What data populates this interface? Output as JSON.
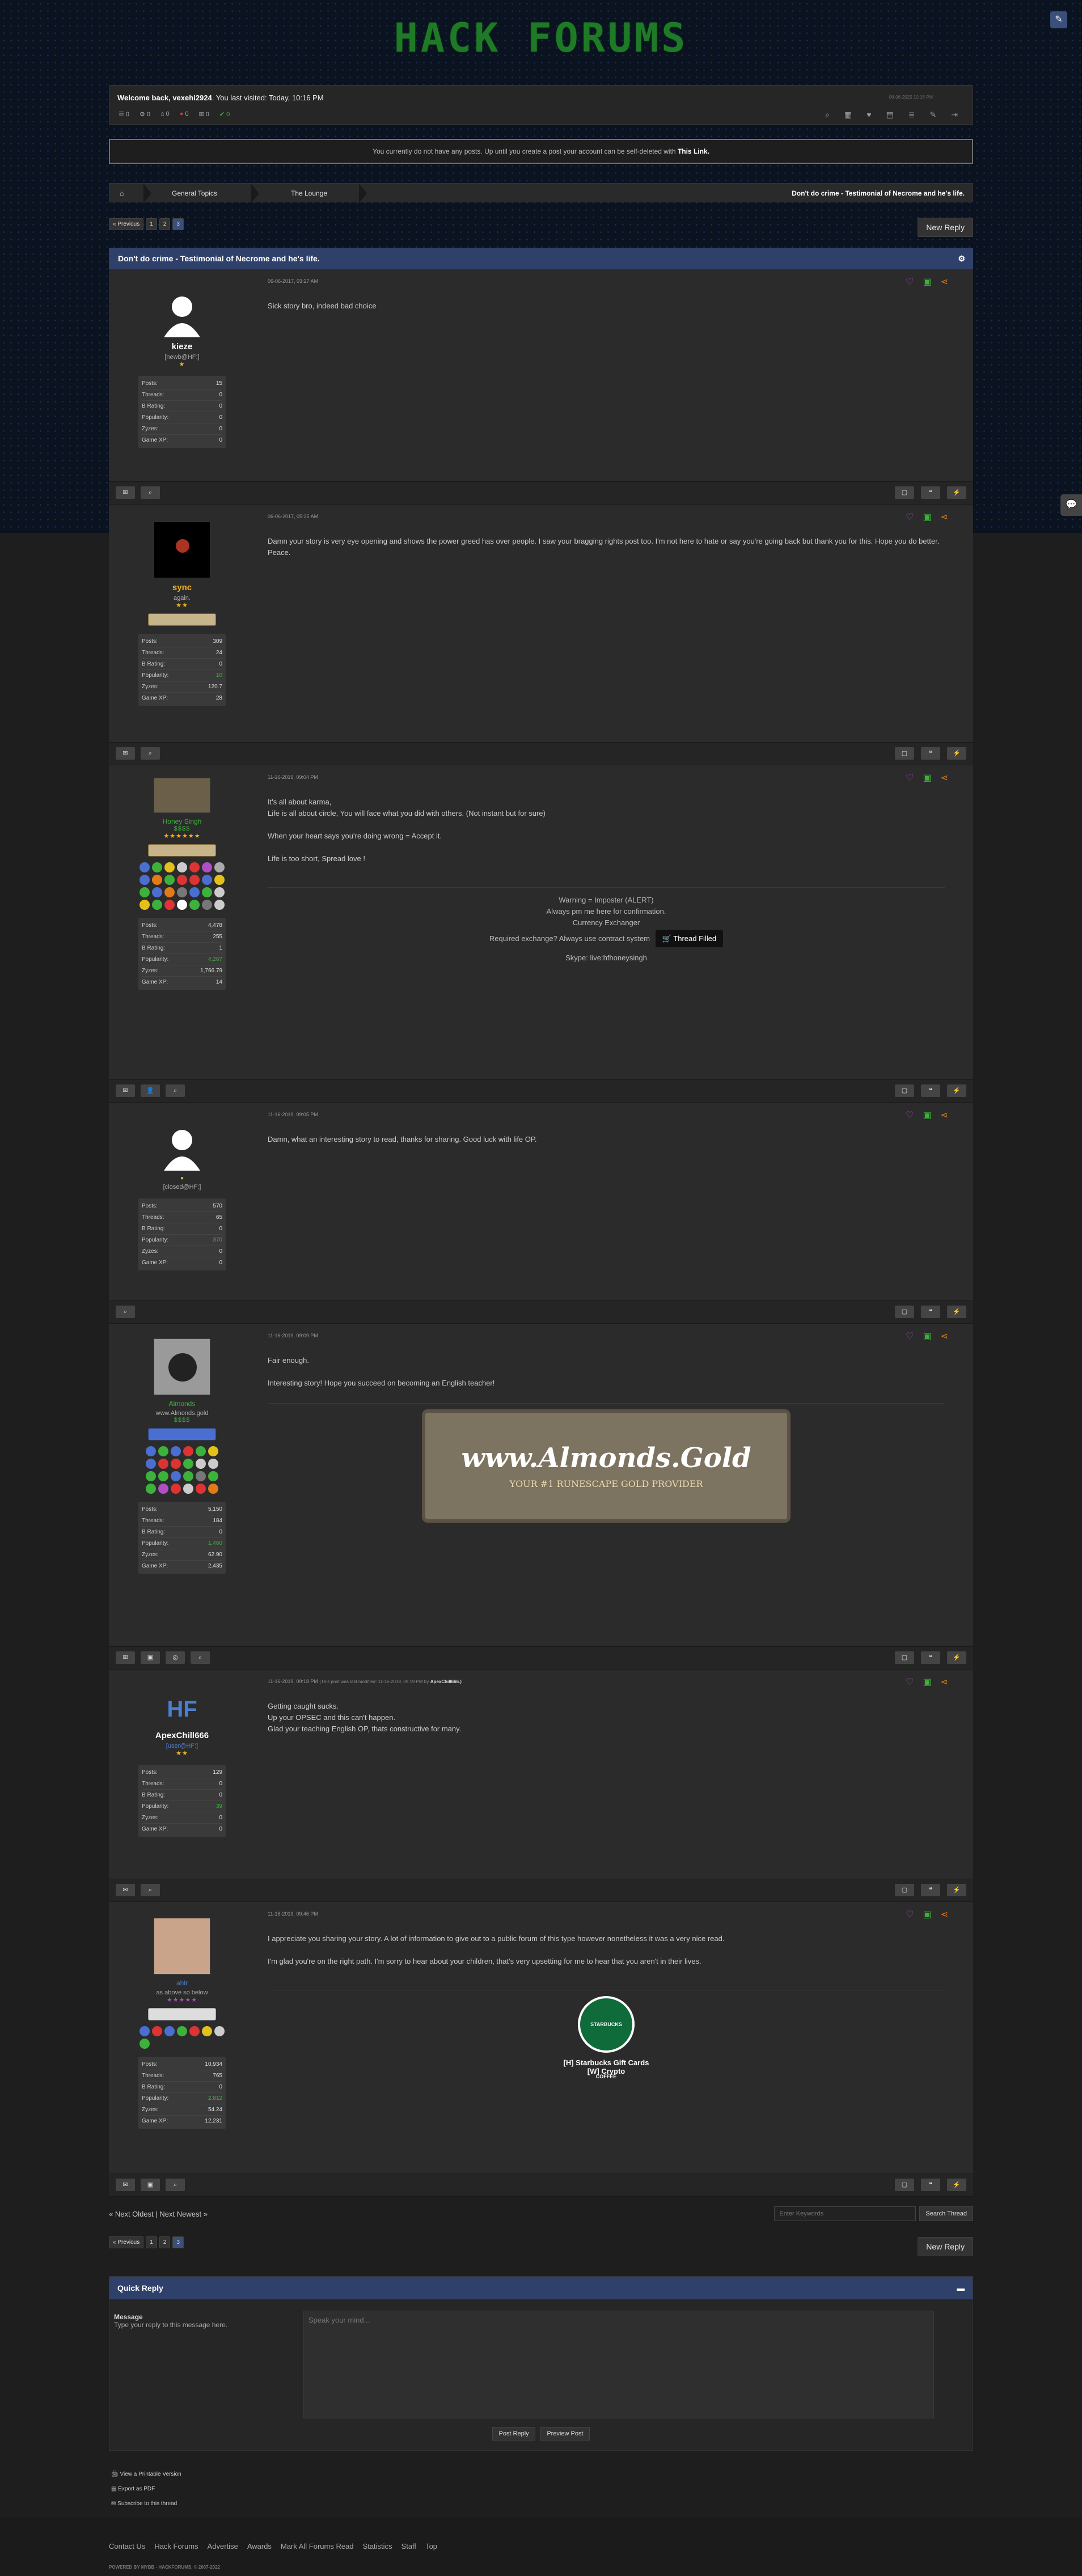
{
  "header": {
    "logo": "HACK FORUMS",
    "edit_icon": "edit-icon"
  },
  "welcome": {
    "text_prefix": "Welcome back,",
    "username": "vexehi2924",
    "text_suffix": ". You last visited: Today, 10:16 PM",
    "datetime": "06-06-2025 10:16 PM",
    "quick": [
      {
        "icon": "☰",
        "label": "0"
      },
      {
        "icon": "⚙",
        "label": "0"
      },
      {
        "icon": "⌂",
        "label": "0"
      },
      {
        "icon": "●",
        "label": "0"
      },
      {
        "icon": "✉",
        "label": "0"
      },
      {
        "icon": "✔",
        "label": "0"
      }
    ]
  },
  "notice": {
    "text": "You currently do not have any posts. Up until you create a post your account can be self-deleted with",
    "link": "This Link."
  },
  "breadcrumb": {
    "home": "⌂",
    "items": [
      "General Topics",
      "The Lounge"
    ],
    "current": "Don't do crime - Testimonial of Necrome and he's life."
  },
  "pagination": {
    "prev": "« Previous",
    "pages": [
      "1",
      "2",
      "3"
    ],
    "active": "3"
  },
  "new_reply": "New Reply",
  "thread": {
    "title": "Don't do crime - Testimonial of Necrome and he's life."
  },
  "posts": [
    {
      "date": "06-06-2017, 03:27 AM",
      "username": "kieze",
      "title": "[newb@HF:]",
      "stars": "★",
      "stats": {
        "posts": "15",
        "threads": "0",
        "brating": "0",
        "popularity": "0",
        "zyzes": "0",
        "gamexp": "0"
      },
      "body": [
        "Sick story bro, indeed bad choice"
      ]
    },
    {
      "date": "06-06-2017, 05:35 AM",
      "username": "sync",
      "title": "again.",
      "stars": "★★",
      "stats": {
        "posts": "309",
        "threads": "24",
        "brating": "0",
        "popularity": "10",
        "zyzes": "120.7",
        "gamexp": "28"
      },
      "body": [
        "Damn your story is very eye opening and shows the power greed has over people. I saw your bragging rights post too. I'm not here to hate or say you're going back but thank you for this. Hope you do better. Peace."
      ]
    },
    {
      "date": "11-16-2019, 09:04 PM",
      "username": "Honey Singh",
      "title": "",
      "stars": "★★★★★★",
      "stats": {
        "posts": "4,478",
        "threads": "255",
        "brating": "1",
        "popularity": "4,267",
        "zyzes": "1,766.79",
        "gamexp": "14"
      },
      "body": [
        "It's all about karma,",
        "Life is all about circle, You will face what you did with others. (Not instant but for sure)",
        "When your heart says you're doing wrong = Accept it.",
        "Life is too short, Spread love !"
      ],
      "sig": [
        "Warning = Imposter (ALERT)",
        "Always pm me here for confirmation.",
        "Currency Exchanger",
        "Required exchange? Always use contract system",
        "Thread Filled",
        "Skype: live:hfhoneysingh"
      ]
    },
    {
      "date": "11-16-2019, 09:05 PM",
      "username": "",
      "title": "[closed@HF:]",
      "stars": "",
      "stats": {
        "posts": "570",
        "threads": "65",
        "brating": "0",
        "popularity": "370",
        "zyzes": "0",
        "gamexp": "0"
      },
      "body": [
        "Damn, what an interesting story to read, thanks for sharing. Good luck with life OP."
      ]
    },
    {
      "date": "11-16-2019, 09:09 PM",
      "username": "Almonds",
      "title": "www.Almonds.gold",
      "stars": "$$$$",
      "stats": {
        "posts": "5,150",
        "threads": "184",
        "brating": "0",
        "popularity": "1,460",
        "zyzes": "62.90",
        "gamexp": "2,435"
      },
      "body": [
        "Fair enough.",
        "Interesting story! Hope you succeed on becoming an English teacher!"
      ],
      "banner": {
        "title": "www.Almonds.Gold",
        "subtitle": "YOUR #1 RUNESCAPE GOLD PROVIDER"
      }
    },
    {
      "date": "11-16-2019, 09:18 PM",
      "edited": "(This post was last modified: 11-16-2019, 09:19 PM by",
      "editor": "ApexChill666.)",
      "username": "ApexChill666",
      "title": "[user@HF:]",
      "stars": "★★",
      "stats": {
        "posts": "129",
        "threads": "0",
        "brating": "0",
        "popularity": "39",
        "zyzes": "0",
        "gamexp": "0"
      },
      "body": [
        "Getting caught sucks.",
        "Up your OPSEC and this can't happen.",
        "Glad your teaching English OP, thats constructive for many."
      ]
    },
    {
      "date": "11-16-2019, 09:46 PM",
      "username": "ahlr",
      "title": "as above so below",
      "stars": "★★★★★",
      "stats": {
        "posts": "10,934",
        "threads": "765",
        "brating": "0",
        "popularity": "2,812",
        "zyzes": "54.24",
        "gamexp": "12,231"
      },
      "body": [
        "I appreciate you sharing your story. A lot of information to give out to a public forum of this type however nonetheless it was a very nice read.",
        "I'm glad you're on the right path. I'm sorry to hear about your children, that's very upsetting for me to hear that you aren't in their lives."
      ],
      "sig": [
        "[H] Starbucks Gift Cards",
        "[W] Crypto"
      ],
      "logo_text": "STARBUCKS COFFEE"
    }
  ],
  "stat_labels": {
    "posts": "Posts:",
    "threads": "Threads:",
    "brating": "B Rating:",
    "popularity": "Popularity:",
    "zyzes": "Zyzes:",
    "gamexp": "Game XP:"
  },
  "nav": {
    "older": "« Next Oldest",
    "sep": "|",
    "newer": "Next Newest »",
    "search_placeholder": "Enter Keywords",
    "search_btn": "Search Thread"
  },
  "quick_reply": {
    "title": "Quick Reply",
    "message_label": "Message",
    "message_hint": "Type your reply to this message here.",
    "placeholder": "Speak your mind...",
    "post_btn": "Post Reply",
    "preview_btn": "Preview Post"
  },
  "options": [
    "View a Printable Version",
    "Export as PDF",
    "Subscribe to this thread"
  ],
  "footer": {
    "links": [
      "Contact Us",
      "Hack Forums",
      "Advertise",
      "Awards",
      "Mark All Forums Read",
      "Statistics",
      "Staff",
      "Top"
    ],
    "powered": "POWERED BY MYBB - HACKFORUMS, © 2007-2022"
  },
  "colors": {
    "accent": "#2f416b",
    "green": "#3cb23c",
    "purple": "#b14ec6",
    "orange": "#e37a1a"
  }
}
